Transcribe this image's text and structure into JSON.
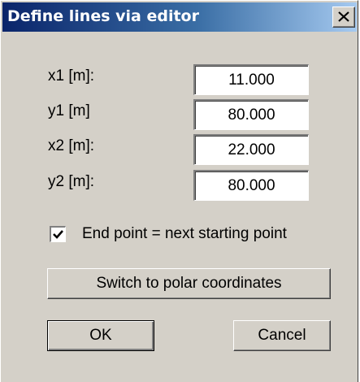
{
  "window": {
    "title": "Define lines via editor",
    "close_icon": "close-icon"
  },
  "fields": [
    {
      "label": "x1 [m]:",
      "value": "11.000"
    },
    {
      "label": "y1 [m]",
      "value": "80.000"
    },
    {
      "label": "x2 [m]:",
      "value": "22.000"
    },
    {
      "label": "y2 [m]:",
      "value": "80.000"
    }
  ],
  "checkbox": {
    "label": "End point = next starting point",
    "checked": true
  },
  "buttons": {
    "switch_label": "Switch to polar coordinates",
    "ok_label": "OK",
    "cancel_label": "Cancel"
  },
  "colors": {
    "face": "#d4d0c8",
    "title_start": "#0a246a",
    "title_end": "#a6caf0"
  }
}
